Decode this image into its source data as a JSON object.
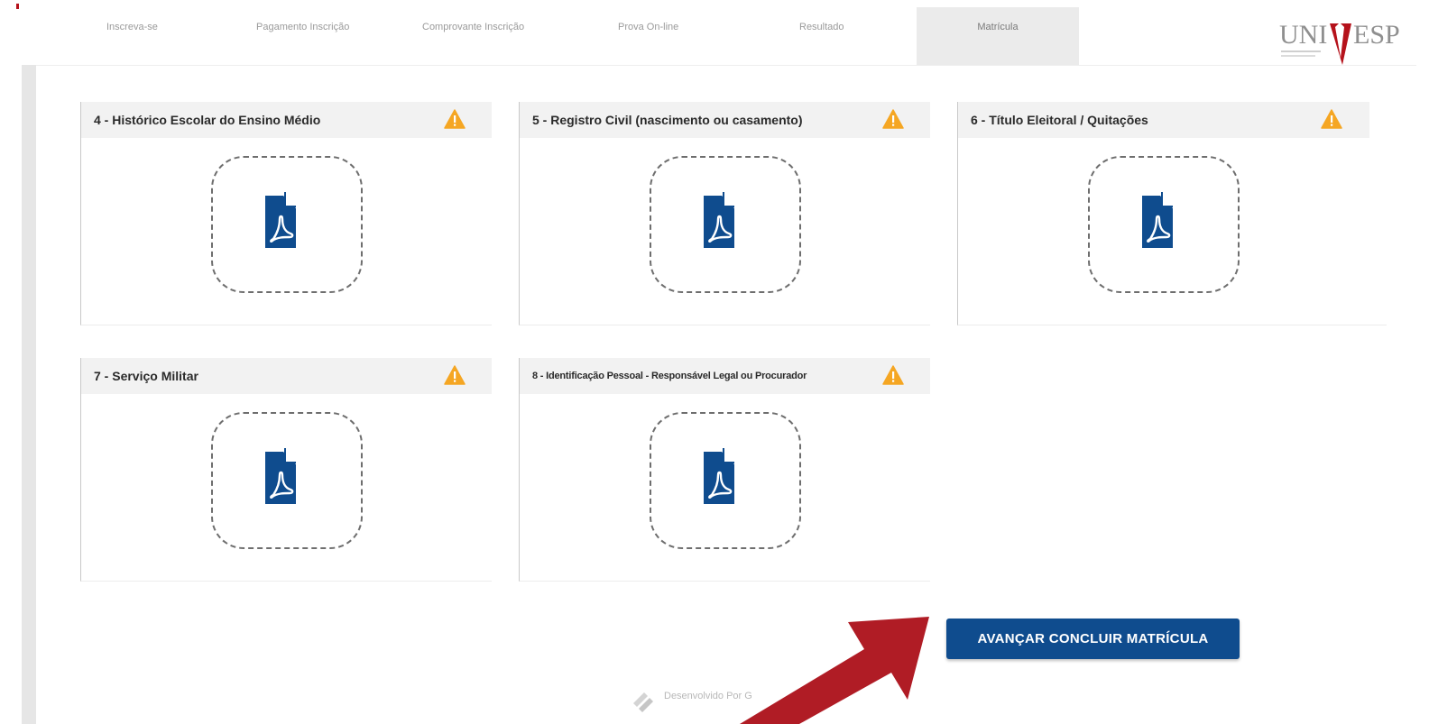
{
  "nav": {
    "tabs": [
      {
        "label": "Inscreva-se"
      },
      {
        "label": "Pagamento Inscrição"
      },
      {
        "label": "Comprovante Inscrição"
      },
      {
        "label": "Prova On-line"
      },
      {
        "label": "Resultado"
      },
      {
        "label": "Matrícula",
        "active": true
      }
    ]
  },
  "logo": {
    "text": "UNIVESP"
  },
  "cards": [
    {
      "title": "4 - Histórico Escolar do Ensino Médio",
      "status_icon": "warning-icon",
      "file_icon": "pdf-icon"
    },
    {
      "title": "5 - Registro Civil (nascimento ou casamento)",
      "status_icon": "warning-icon",
      "file_icon": "pdf-icon"
    },
    {
      "title": "6 - Título Eleitoral / Quitações",
      "status_icon": "warning-icon",
      "file_icon": "pdf-icon"
    },
    {
      "title": "7 - Serviço Militar",
      "status_icon": "warning-icon",
      "file_icon": "pdf-icon"
    },
    {
      "title": "8 - Identificação Pessoal - Responsável Legal ou Procurador",
      "status_icon": "warning-icon",
      "file_icon": "pdf-icon"
    }
  ],
  "actions": {
    "submit_label": "AVANÇAR CONCLUIR MATRÍCULA"
  },
  "footer": {
    "text": "Desenvolvido Por G"
  },
  "colors": {
    "primary_button": "#0f4c8e",
    "arrow": "#b01c25",
    "warning": "#f5a623",
    "pdf_icon": "#0f4c8e",
    "brand_red": "#b5121b"
  }
}
